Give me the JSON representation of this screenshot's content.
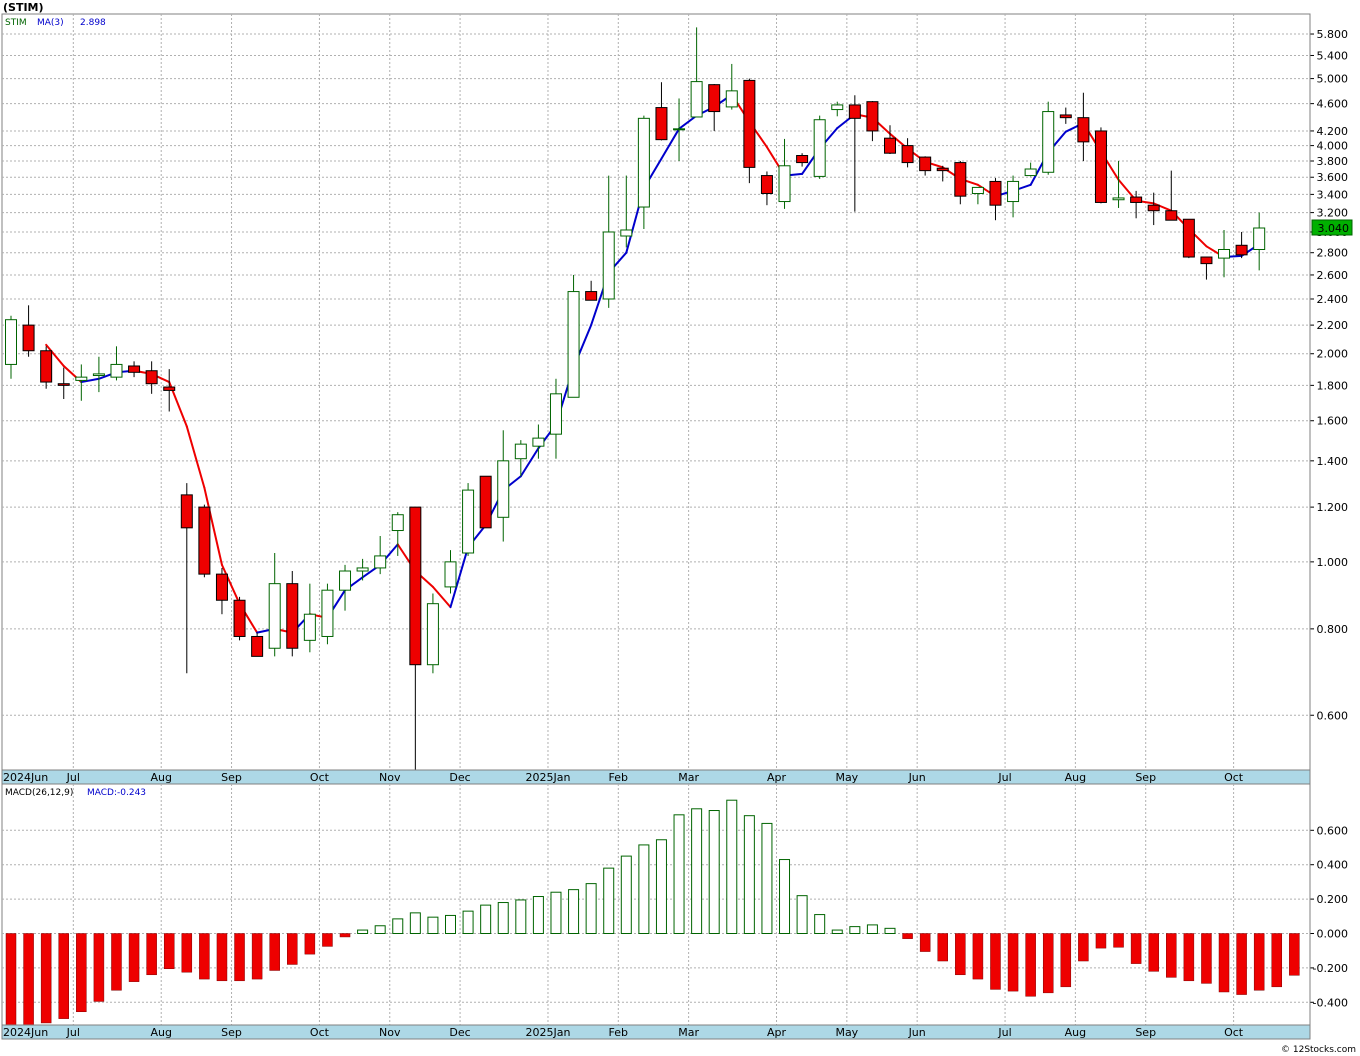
{
  "symbol_title": "(STIM)",
  "price_panel": {
    "legend_symbol": "STIM",
    "legend_ma": "MA(3)",
    "legend_ma_value": "2.898",
    "last_price_label": "3.040",
    "scale": "log",
    "y_ticks": [
      "0.600",
      "0.800",
      "1.000",
      "1.200",
      "1.400",
      "1.600",
      "1.800",
      "2.000",
      "2.200",
      "2.400",
      "2.600",
      "2.800",
      "3.000",
      "3.200",
      "3.400",
      "3.600",
      "3.800",
      "4.000",
      "4.200",
      "4.600",
      "5.000",
      "5.400",
      "5.800"
    ],
    "colors": {
      "up_fill": "#ffffff",
      "up_stroke": "#006400",
      "down_fill": "#ee0000",
      "down_stroke": "#000000",
      "ma_up": "#0000cc",
      "ma_down": "#ee0000"
    }
  },
  "macd_panel": {
    "legend_name": "MACD(26,12,9)",
    "legend_value": "MACD:-0.243",
    "y_ticks": [
      "-0.400",
      "-0.200",
      "0.000",
      "0.200",
      "0.400",
      "0.600"
    ],
    "colors": {
      "pos_stroke": "#006400",
      "neg_fill": "#ee0000"
    }
  },
  "x_labels": [
    "2024Jun",
    "Jul",
    "Aug",
    "Sep",
    "Oct",
    "Nov",
    "Dec",
    "2025Jan",
    "Feb",
    "Mar",
    "Apr",
    "May",
    "Jun",
    "Jul",
    "Aug",
    "Sep",
    "Oct"
  ],
  "x_label_weeks": [
    0,
    4,
    9,
    13,
    18,
    22,
    26,
    31,
    35,
    39,
    44,
    48,
    52,
    57,
    61,
    65,
    70
  ],
  "footer": "© 12Stocks.com",
  "chart_data": {
    "type": "candlestick",
    "title": "(STIM)",
    "frequency": "weekly",
    "y_scale": "log",
    "ylim": [
      0.5,
      6.2
    ],
    "ohlc": [
      {
        "o": 1.93,
        "h": 2.27,
        "l": 1.84,
        "c": 2.24
      },
      {
        "o": 2.2,
        "h": 2.35,
        "l": 1.98,
        "c": 2.02
      },
      {
        "o": 2.02,
        "h": 2.05,
        "l": 1.78,
        "c": 1.82
      },
      {
        "o": 1.81,
        "h": 1.91,
        "l": 1.72,
        "c": 1.8
      },
      {
        "o": 1.83,
        "h": 1.93,
        "l": 1.71,
        "c": 1.85
      },
      {
        "o": 1.86,
        "h": 1.98,
        "l": 1.76,
        "c": 1.87
      },
      {
        "o": 1.85,
        "h": 2.05,
        "l": 1.83,
        "c": 1.93
      },
      {
        "o": 1.92,
        "h": 1.95,
        "l": 1.85,
        "c": 1.88
      },
      {
        "o": 1.89,
        "h": 1.95,
        "l": 1.75,
        "c": 1.81
      },
      {
        "o": 1.79,
        "h": 1.9,
        "l": 1.65,
        "c": 1.77
      },
      {
        "o": 1.25,
        "h": 1.3,
        "l": 0.69,
        "c": 1.12
      },
      {
        "o": 1.2,
        "h": 1.21,
        "l": 0.95,
        "c": 0.96
      },
      {
        "o": 0.96,
        "h": 0.98,
        "l": 0.84,
        "c": 0.88
      },
      {
        "o": 0.88,
        "h": 0.89,
        "l": 0.77,
        "c": 0.78
      },
      {
        "o": 0.78,
        "h": 0.79,
        "l": 0.73,
        "c": 0.73
      },
      {
        "o": 0.75,
        "h": 1.03,
        "l": 0.73,
        "c": 0.93
      },
      {
        "o": 0.93,
        "h": 0.97,
        "l": 0.73,
        "c": 0.75
      },
      {
        "o": 0.77,
        "h": 0.93,
        "l": 0.74,
        "c": 0.84
      },
      {
        "o": 0.78,
        "h": 0.93,
        "l": 0.76,
        "c": 0.91
      },
      {
        "o": 0.91,
        "h": 0.99,
        "l": 0.85,
        "c": 0.97
      },
      {
        "o": 0.97,
        "h": 1.01,
        "l": 0.94,
        "c": 0.98
      },
      {
        "o": 0.98,
        "h": 1.09,
        "l": 0.96,
        "c": 1.02
      },
      {
        "o": 1.11,
        "h": 1.18,
        "l": 1.02,
        "c": 1.17
      },
      {
        "o": 1.2,
        "h": 1.2,
        "l": 0.49,
        "c": 0.71
      },
      {
        "o": 0.71,
        "h": 0.9,
        "l": 0.69,
        "c": 0.87
      },
      {
        "o": 0.92,
        "h": 1.04,
        "l": 0.9,
        "c": 1.0
      },
      {
        "o": 1.03,
        "h": 1.3,
        "l": 1.02,
        "c": 1.27
      },
      {
        "o": 1.33,
        "h": 1.33,
        "l": 1.12,
        "c": 1.12
      },
      {
        "o": 1.16,
        "h": 1.55,
        "l": 1.07,
        "c": 1.4
      },
      {
        "o": 1.41,
        "h": 1.5,
        "l": 1.33,
        "c": 1.48
      },
      {
        "o": 1.47,
        "h": 1.58,
        "l": 1.41,
        "c": 1.51
      },
      {
        "o": 1.53,
        "h": 1.84,
        "l": 1.41,
        "c": 1.75
      },
      {
        "o": 1.73,
        "h": 2.6,
        "l": 1.73,
        "c": 2.46
      },
      {
        "o": 2.46,
        "h": 2.55,
        "l": 2.39,
        "c": 2.39
      },
      {
        "o": 2.4,
        "h": 3.62,
        "l": 2.33,
        "c": 3.0
      },
      {
        "o": 2.96,
        "h": 3.62,
        "l": 2.85,
        "c": 3.02
      },
      {
        "o": 3.26,
        "h": 4.42,
        "l": 3.03,
        "c": 4.38
      },
      {
        "o": 4.54,
        "h": 4.94,
        "l": 4.07,
        "c": 4.08
      },
      {
        "o": 4.22,
        "h": 4.68,
        "l": 3.8,
        "c": 4.23
      },
      {
        "o": 4.4,
        "h": 5.93,
        "l": 4.4,
        "c": 4.95
      },
      {
        "o": 4.9,
        "h": 4.91,
        "l": 4.2,
        "c": 4.48
      },
      {
        "o": 4.55,
        "h": 5.25,
        "l": 4.51,
        "c": 4.8
      },
      {
        "o": 4.97,
        "h": 5.0,
        "l": 3.53,
        "c": 3.72
      },
      {
        "o": 3.62,
        "h": 3.67,
        "l": 3.28,
        "c": 3.41
      },
      {
        "o": 3.32,
        "h": 4.09,
        "l": 3.24,
        "c": 3.74
      },
      {
        "o": 3.87,
        "h": 3.9,
        "l": 3.73,
        "c": 3.78
      },
      {
        "o": 3.61,
        "h": 4.42,
        "l": 3.58,
        "c": 4.36
      },
      {
        "o": 4.51,
        "h": 4.63,
        "l": 4.41,
        "c": 4.58
      },
      {
        "o": 4.58,
        "h": 4.73,
        "l": 3.21,
        "c": 4.38
      },
      {
        "o": 4.63,
        "h": 4.64,
        "l": 4.06,
        "c": 4.2
      },
      {
        "o": 4.1,
        "h": 4.28,
        "l": 3.89,
        "c": 3.9
      },
      {
        "o": 4.0,
        "h": 4.1,
        "l": 3.72,
        "c": 3.78
      },
      {
        "o": 3.85,
        "h": 3.86,
        "l": 3.62,
        "c": 3.68
      },
      {
        "o": 3.71,
        "h": 3.74,
        "l": 3.55,
        "c": 3.68
      },
      {
        "o": 3.78,
        "h": 3.8,
        "l": 3.29,
        "c": 3.38
      },
      {
        "o": 3.41,
        "h": 3.46,
        "l": 3.29,
        "c": 3.48
      },
      {
        "o": 3.55,
        "h": 3.59,
        "l": 3.12,
        "c": 3.28
      },
      {
        "o": 3.32,
        "h": 3.62,
        "l": 3.15,
        "c": 3.55
      },
      {
        "o": 3.62,
        "h": 3.78,
        "l": 3.61,
        "c": 3.7
      },
      {
        "o": 3.66,
        "h": 4.63,
        "l": 3.63,
        "c": 4.48
      },
      {
        "o": 4.43,
        "h": 4.54,
        "l": 4.3,
        "c": 4.39
      },
      {
        "o": 4.39,
        "h": 4.77,
        "l": 3.8,
        "c": 4.05
      },
      {
        "o": 4.2,
        "h": 4.25,
        "l": 3.3,
        "c": 3.31
      },
      {
        "o": 3.34,
        "h": 3.8,
        "l": 3.25,
        "c": 3.36
      },
      {
        "o": 3.37,
        "h": 3.44,
        "l": 3.14,
        "c": 3.31
      },
      {
        "o": 3.28,
        "h": 3.42,
        "l": 3.07,
        "c": 3.22
      },
      {
        "o": 3.22,
        "h": 3.68,
        "l": 3.13,
        "c": 3.12
      },
      {
        "o": 3.13,
        "h": 3.13,
        "l": 2.75,
        "c": 2.76
      },
      {
        "o": 2.76,
        "h": 2.76,
        "l": 2.56,
        "c": 2.7
      },
      {
        "o": 2.75,
        "h": 3.02,
        "l": 2.58,
        "c": 2.83
      },
      {
        "o": 2.87,
        "h": 3.0,
        "l": 2.75,
        "c": 2.78
      },
      {
        "o": 2.83,
        "h": 3.2,
        "l": 2.64,
        "c": 3.04
      }
    ],
    "ma3": [
      null,
      null,
      2.06,
      1.92,
      1.82,
      1.84,
      1.88,
      1.89,
      1.87,
      1.82,
      1.57,
      1.28,
      0.99,
      0.87,
      0.79,
      0.8,
      0.79,
      0.84,
      0.83,
      0.91,
      0.95,
      0.99,
      1.06,
      0.97,
      0.92,
      0.86,
      1.05,
      1.13,
      1.27,
      1.33,
      1.46,
      1.58,
      1.91,
      2.2,
      2.62,
      2.8,
      3.47,
      3.83,
      4.23,
      4.42,
      4.55,
      4.74,
      4.33,
      3.98,
      3.62,
      3.64,
      3.96,
      4.24,
      4.44,
      4.39,
      4.16,
      3.96,
      3.79,
      3.72,
      3.58,
      3.51,
      3.38,
      3.44,
      3.51,
      3.91,
      4.19,
      4.31,
      3.92,
      3.57,
      3.33,
      3.3,
      3.22,
      3.03,
      2.86,
      2.76,
      2.77,
      2.88
    ],
    "macd": [
      -0.548,
      -0.545,
      -0.52,
      -0.495,
      -0.455,
      -0.395,
      -0.33,
      -0.28,
      -0.24,
      -0.205,
      -0.225,
      -0.265,
      -0.275,
      -0.275,
      -0.265,
      -0.215,
      -0.18,
      -0.12,
      -0.075,
      -0.02,
      0.02,
      0.045,
      0.085,
      0.12,
      0.095,
      0.105,
      0.13,
      0.165,
      0.18,
      0.195,
      0.215,
      0.24,
      0.255,
      0.29,
      0.38,
      0.45,
      0.515,
      0.545,
      0.69,
      0.725,
      0.715,
      0.775,
      0.685,
      0.64,
      0.43,
      0.22,
      0.11,
      0.02,
      0.04,
      0.05,
      0.03,
      -0.03,
      -0.105,
      -0.16,
      -0.24,
      -0.265,
      -0.325,
      -0.335,
      -0.365,
      -0.345,
      -0.31,
      -0.16,
      -0.085,
      -0.08,
      -0.175,
      -0.22,
      -0.255,
      -0.275,
      -0.29,
      -0.34,
      -0.355,
      -0.33,
      -0.31,
      -0.243
    ]
  }
}
